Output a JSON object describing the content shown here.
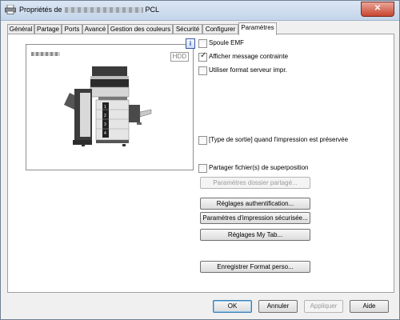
{
  "window": {
    "title_prefix": "Propriétés de",
    "title_suffix": "PCL",
    "close_glyph": "✕"
  },
  "tabs": [
    {
      "label": "Général",
      "active": false
    },
    {
      "label": "Partage",
      "active": false
    },
    {
      "label": "Ports",
      "active": false
    },
    {
      "label": "Avancé",
      "active": false
    },
    {
      "label": "Gestion des couleurs",
      "active": false
    },
    {
      "label": "Sécurité",
      "active": false
    },
    {
      "label": "Configurer",
      "active": false
    },
    {
      "label": "Paramètres",
      "active": true
    }
  ],
  "preview": {
    "hdd_label": "HDD",
    "tray_numbers": [
      "1",
      "2",
      "3",
      "4"
    ]
  },
  "info_glyph": "i",
  "options": {
    "spool_emf": {
      "label": "Spoule EMF",
      "checked": false
    },
    "show_constraint": {
      "label": "Afficher message contrainte",
      "checked": true
    },
    "server_format": {
      "label": "Utiliser format serveur impr.",
      "checked": false
    },
    "output_type": {
      "label": "[Type de sortie] quand l'impression est préservée",
      "checked": false
    },
    "share_overlay": {
      "label": "Partager fichier(s) de superposition",
      "checked": false
    }
  },
  "buttons": {
    "shared_folder": {
      "label": "Paramètres dossier partagé...",
      "disabled": true
    },
    "auth_settings": {
      "label": "Réglages authentification..."
    },
    "secure_print": {
      "label": "Paramètres d'impression sécurisée..."
    },
    "my_tab": {
      "label": "Réglages My Tab..."
    },
    "save_format": {
      "label": "Enregistrer Format perso..."
    }
  },
  "dialog_buttons": {
    "ok": "OK",
    "cancel": "Annuler",
    "apply": "Appliquer",
    "help": "Aide"
  }
}
